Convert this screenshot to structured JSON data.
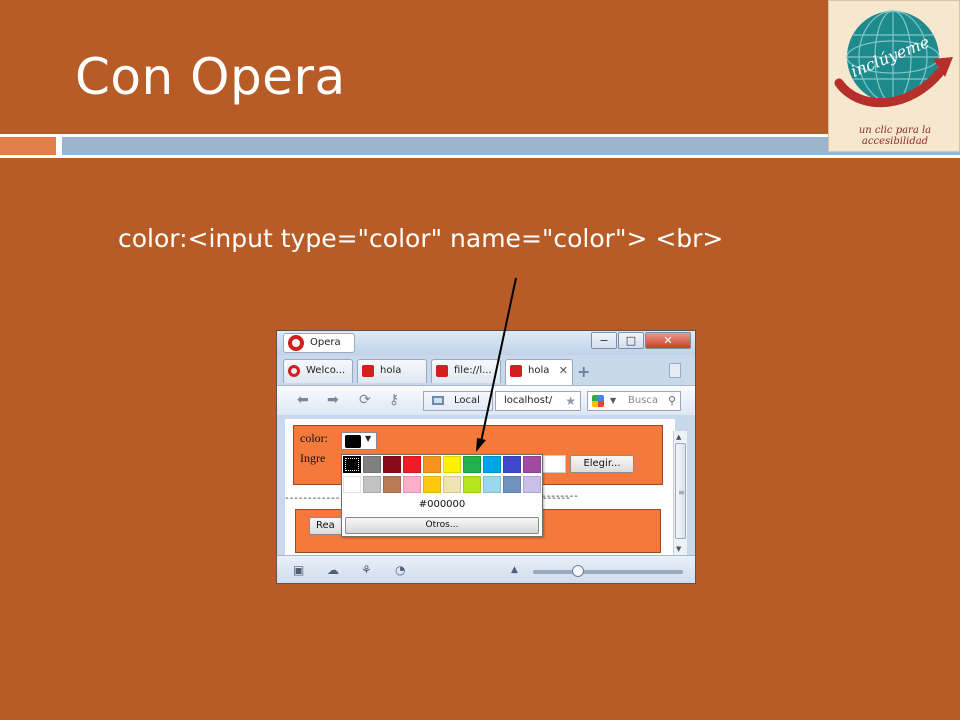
{
  "slide": {
    "title": "Con Opera",
    "code_line": "color:<input type=\"color\" name=\"color\"> <br>",
    "background_color": "#B85C27"
  },
  "logo": {
    "wordmark": "inclúyeme",
    "caption": "un clic para la accesibilidad"
  },
  "browser": {
    "menu_button": "Opera",
    "window_controls": [
      "−",
      "□",
      "✕"
    ],
    "tabs": [
      {
        "label": "Welco...",
        "icon": "opera-icon"
      },
      {
        "label": "hola",
        "icon": "page-icon"
      },
      {
        "label": "file://l...",
        "icon": "page-icon"
      },
      {
        "label": "hola",
        "icon": "page-icon",
        "active": true
      }
    ],
    "address": {
      "local_label": "Local",
      "url": "localhost/"
    },
    "search": {
      "placeholder": "Busca"
    },
    "page": {
      "color_label": "color:",
      "ingresa_label": "Ingre",
      "choose_button": "Elegir...",
      "submit_button": "Rea"
    },
    "color_picker": {
      "selected_hex": "#000000",
      "other_button": "Otros...",
      "row1": [
        "#000000",
        "#808080",
        "#8B0A1A",
        "#EE1C25",
        "#F7931E",
        "#FFF200",
        "#22B14C",
        "#00A2E8",
        "#3F48CC",
        "#A349A4"
      ],
      "row2": [
        "#FFFFFF",
        "#C3C3C3",
        "#B97A57",
        "#FFAEC9",
        "#FFC90E",
        "#EFE4B0",
        "#B5E61D",
        "#99D9EA",
        "#7092BE",
        "#C8BFE7"
      ]
    },
    "zoom_level": 0.3
  }
}
